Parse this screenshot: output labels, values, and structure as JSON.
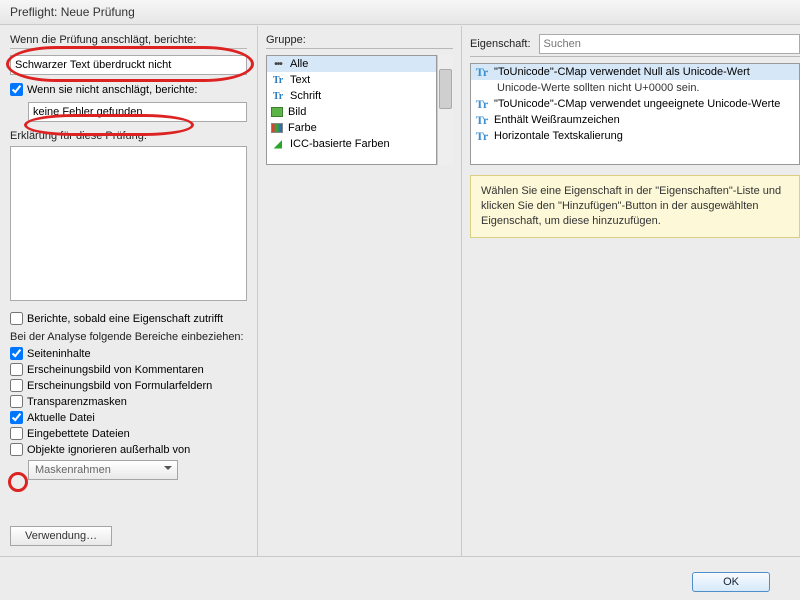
{
  "window": {
    "title": "Preflight: Neue Prüfung"
  },
  "left": {
    "when_hits_label": "Wenn die Prüfung anschlägt, berichte:",
    "when_hits_value": "Schwarzer Text überdruckt nicht",
    "when_not_label": "Wenn sie nicht anschlägt, berichte:",
    "when_not_value": "keine Fehler gefunden",
    "explanation_label": "Erklärung für diese Prüfung:",
    "explanation_value": ""
  },
  "options": {
    "report_once": "Berichte, sobald eine Eigenschaft zutrifft",
    "include_label": "Bei der Analyse folgende Bereiche einbeziehen:",
    "seiteninhalte": "Seiteninhalte",
    "kommentare": "Erscheinungsbild von Kommentaren",
    "formular": "Erscheinungsbild von Formularfeldern",
    "transparenz": "Transparenzmasken",
    "aktuelle": "Aktuelle Datei",
    "eingebettete": "Eingebettete Dateien",
    "ignore": "Objekte ignorieren außerhalb von",
    "maskbox": "Maskenrahmen",
    "verwendung": "Verwendung…"
  },
  "group": {
    "label": "Gruppe:",
    "items": [
      {
        "icon": "alle",
        "label": "Alle"
      },
      {
        "icon": "text",
        "label": "Text"
      },
      {
        "icon": "text",
        "label": "Schrift"
      },
      {
        "icon": "bild",
        "label": "Bild"
      },
      {
        "icon": "farbe",
        "label": "Farbe"
      },
      {
        "icon": "icc",
        "label": "ICC-basierte Farben"
      }
    ]
  },
  "prop": {
    "label": "Eigenschaft:",
    "search_placeholder": "Suchen",
    "items": [
      "\"ToUnicode\"-CMap verwendet Null als Unicode-Wert",
      "Unicode-Werte sollten nicht U+0000 sein.",
      "\"ToUnicode\"-CMap verwendet ungeeignete Unicode-Werte",
      "Enthält Weißraumzeichen",
      "Horizontale Textskalierung"
    ]
  },
  "hint": "Wählen Sie eine Eigenschaft in der \"Eigenschaften\"-Liste und klicken Sie den \"Hinzufügen\"-Button in der ausgewählten Eigenschaft, um diese hinzuzufügen.",
  "buttons": {
    "ok": "OK"
  }
}
